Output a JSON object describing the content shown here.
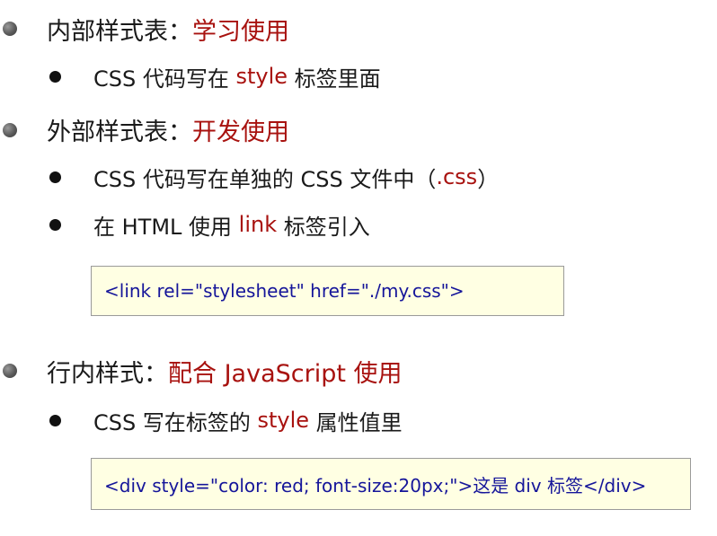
{
  "sections": [
    {
      "label": "内部样式表：",
      "highlight": "学习使用",
      "items": [
        {
          "pre": "CSS 代码写在 ",
          "hl": "style",
          "post": " 标签里面"
        }
      ]
    },
    {
      "label": "外部样式表：",
      "highlight": "开发使用",
      "items": [
        {
          "pre": "CSS 代码写在单独的 CSS 文件中（",
          "hl": ".css",
          "post": "）"
        },
        {
          "pre": "在 HTML 使用 ",
          "hl": "link",
          "post": " 标签引入"
        }
      ],
      "code": "<link rel=\"stylesheet\" href=\"./my.css\">"
    },
    {
      "label": "行内样式：",
      "highlight": "配合 JavaScript 使用",
      "items": [
        {
          "pre": "CSS 写在标签的 ",
          "hl": "style",
          "post": " 属性值里"
        }
      ],
      "code": "<div style=\"color: red; font-size:20px;\">这是 div 标签</div>"
    }
  ],
  "colors": {
    "highlight": "#a8120f",
    "code_text": "#15159a",
    "code_background": "#ffffe3",
    "bullet_primary": "#5a5a5a",
    "bullet_secondary": "#111111"
  }
}
